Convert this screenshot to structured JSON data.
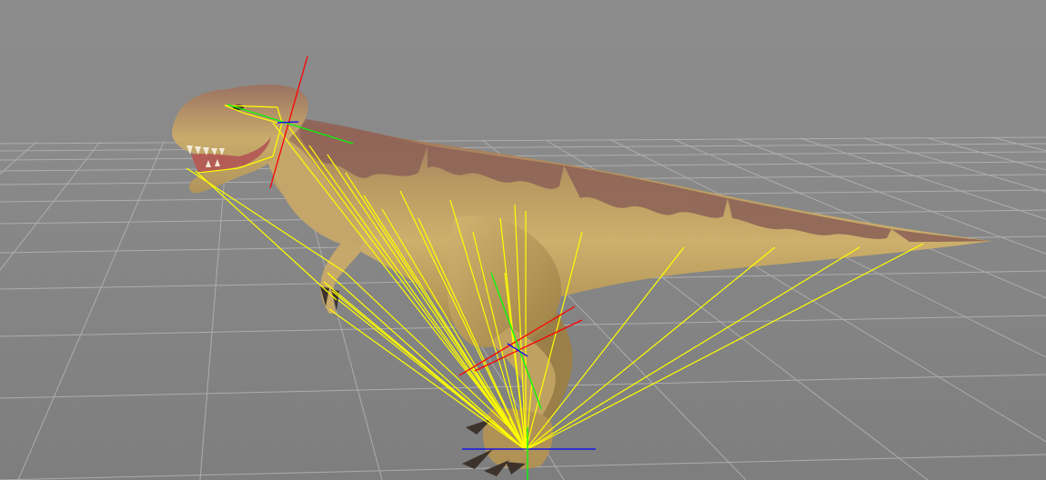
{
  "viewport": {
    "background_color": "#8a8a8a",
    "grid_color": "#b4b4b4"
  },
  "model": {
    "skin_base_color": "#c8a862",
    "skin_stripe_color": "#8f6458",
    "claw_color": "#3d332c"
  },
  "rig": {
    "influence_line_color": "#ffff00",
    "axis_x_color": "#ff0000",
    "axis_y_color": "#00ff00",
    "axis_z_color": "#0000ff"
  }
}
